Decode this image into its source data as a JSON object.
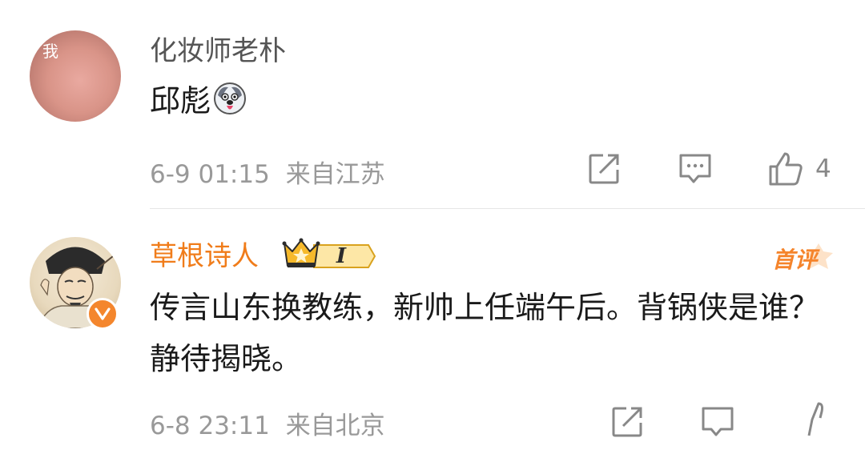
{
  "comments": [
    {
      "user": "化妆师老朴",
      "avatar_text": "我",
      "content": "邱彪",
      "time": "6-9 01:15",
      "location": "来自江苏",
      "likes": "4",
      "icons": [
        "dog-emoji-icon",
        "repost-icon",
        "reply-icon",
        "like-icon"
      ]
    },
    {
      "user": "草根诗人",
      "badge_text": "I",
      "top_label": "首评",
      "content": "传言山东换教练，新帅上任端午后。背锅侠是谁？静待揭晓。",
      "time": "6-8 23:11",
      "location": "来自北京",
      "icons": [
        "crown-icon",
        "verified-icon",
        "repost-icon",
        "reply-icon",
        "like-icon"
      ]
    }
  ],
  "colors": {
    "username_vip": "#f07c1a",
    "meta": "#999999",
    "icon": "#888888",
    "badge_orange": "#f4862d"
  }
}
